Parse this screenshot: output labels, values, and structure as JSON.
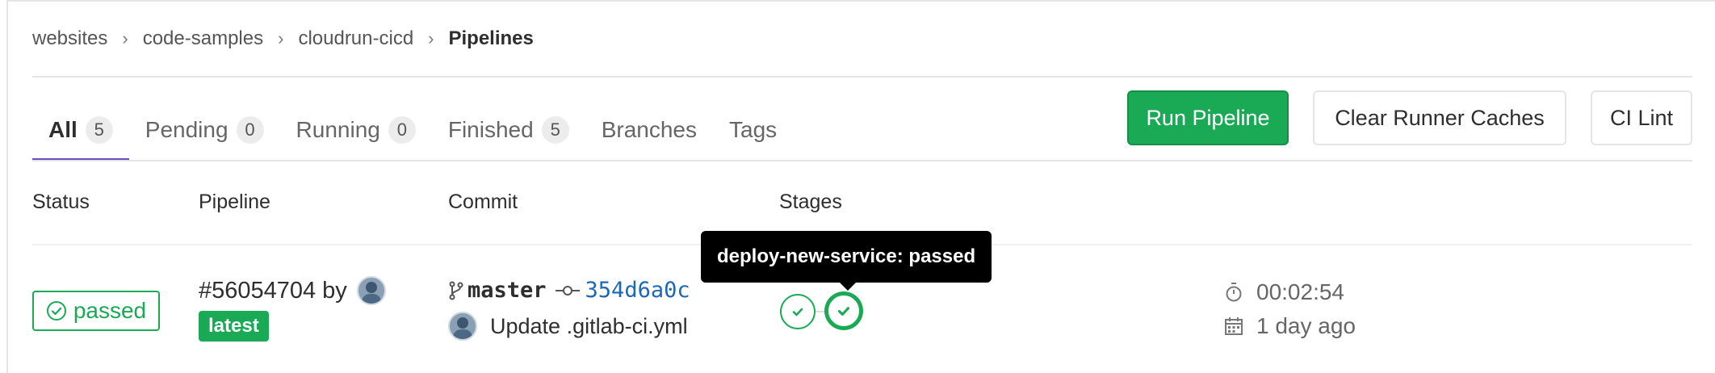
{
  "breadcrumb": {
    "items": [
      "websites",
      "code-samples",
      "cloudrun-cicd"
    ],
    "current": "Pipelines",
    "separator": "›"
  },
  "tabs": [
    {
      "label": "All",
      "count": "5",
      "active": true
    },
    {
      "label": "Pending",
      "count": "0"
    },
    {
      "label": "Running",
      "count": "0"
    },
    {
      "label": "Finished",
      "count": "5"
    },
    {
      "label": "Branches"
    },
    {
      "label": "Tags"
    }
  ],
  "actions": {
    "run_pipeline": "Run Pipeline",
    "clear_caches": "Clear Runner Caches",
    "ci_lint": "CI Lint"
  },
  "table": {
    "headers": {
      "status": "Status",
      "pipeline": "Pipeline",
      "commit": "Commit",
      "stages": "Stages"
    },
    "row": {
      "status": "passed",
      "pipeline_id": "#56054704",
      "by": "by",
      "tag": "latest",
      "branch": "master",
      "sha": "354d6a0c",
      "message": "Update .gitlab-ci.yml",
      "duration": "00:02:54",
      "finished": "1 day ago",
      "tooltip": "deploy-new-service: passed"
    }
  },
  "colors": {
    "success": "#1aaa55",
    "active_tab": "#6b4fbb",
    "link": "#1b69b6"
  }
}
